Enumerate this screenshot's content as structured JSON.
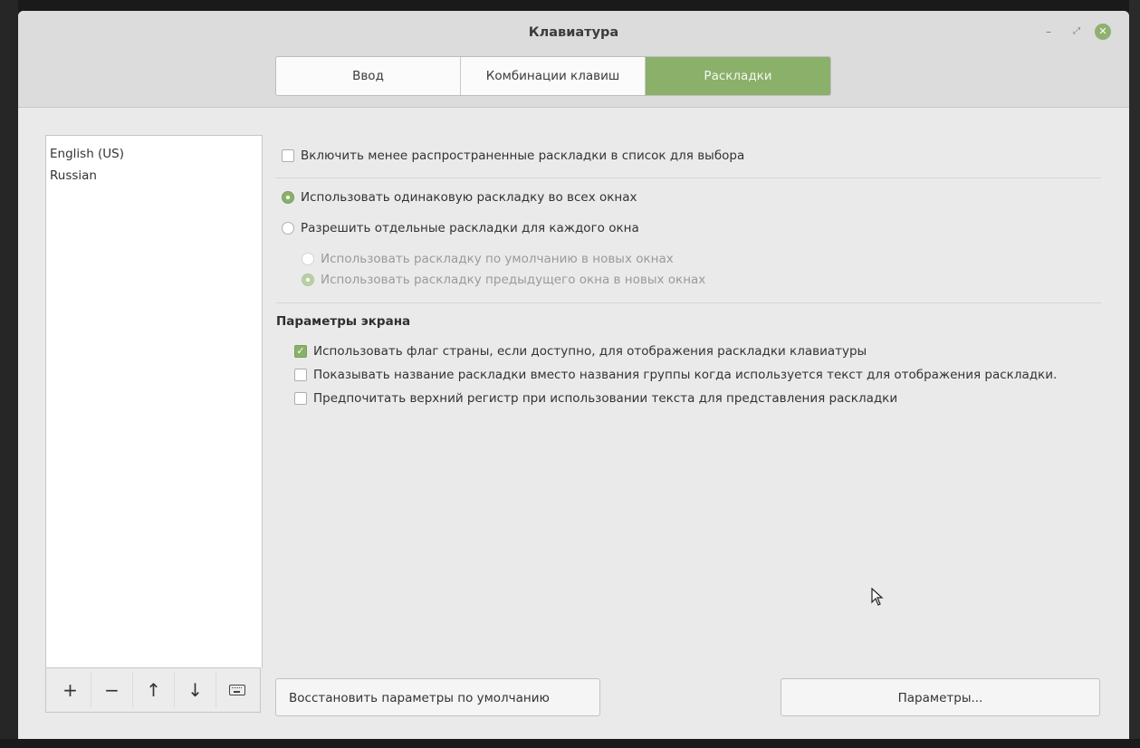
{
  "window": {
    "title": "Клавиатура"
  },
  "tabs": [
    {
      "label": "Ввод",
      "active": false
    },
    {
      "label": "Комбинации клавиш",
      "active": false
    },
    {
      "label": "Раскладки",
      "active": true
    }
  ],
  "layouts": {
    "items": [
      "English (US)",
      "Russian"
    ]
  },
  "list_toolbar": {
    "add": "+",
    "remove": "−",
    "up": "↑",
    "down": "↓"
  },
  "options": {
    "include_less_common": {
      "label": "Включить менее распространенные раскладки в список для выбора",
      "checked": false
    },
    "same_layout_all": {
      "label": "Использовать одинаковую раскладку во всех окнах",
      "selected": true
    },
    "separate_per_window": {
      "label": "Разрешить отдельные раскладки для каждого окна",
      "selected": false
    },
    "default_in_new": {
      "label": "Использовать раскладку по умолчанию в новых окнах",
      "selected": false,
      "enabled": false
    },
    "previous_in_new": {
      "label": "Использовать раскладку предыдущего окна в новых окнах",
      "selected": true,
      "enabled": false
    }
  },
  "display": {
    "section_title": "Параметры экрана",
    "use_flag": {
      "label": "Использовать флаг страны, если доступно, для отображения раскладки клавиатуры",
      "checked": true
    },
    "show_layout_name": {
      "label": "Показывать название раскладки вместо названия группы когда используется текст для отображения раскладки.",
      "checked": false
    },
    "prefer_uppercase": {
      "label": "Предпочитать верхний регистр при использовании текста для представления раскладки",
      "checked": false
    }
  },
  "buttons": {
    "reset": "Восстановить параметры по умолчанию",
    "params": "Параметры..."
  },
  "colors": {
    "accent": "#8ab06a"
  }
}
